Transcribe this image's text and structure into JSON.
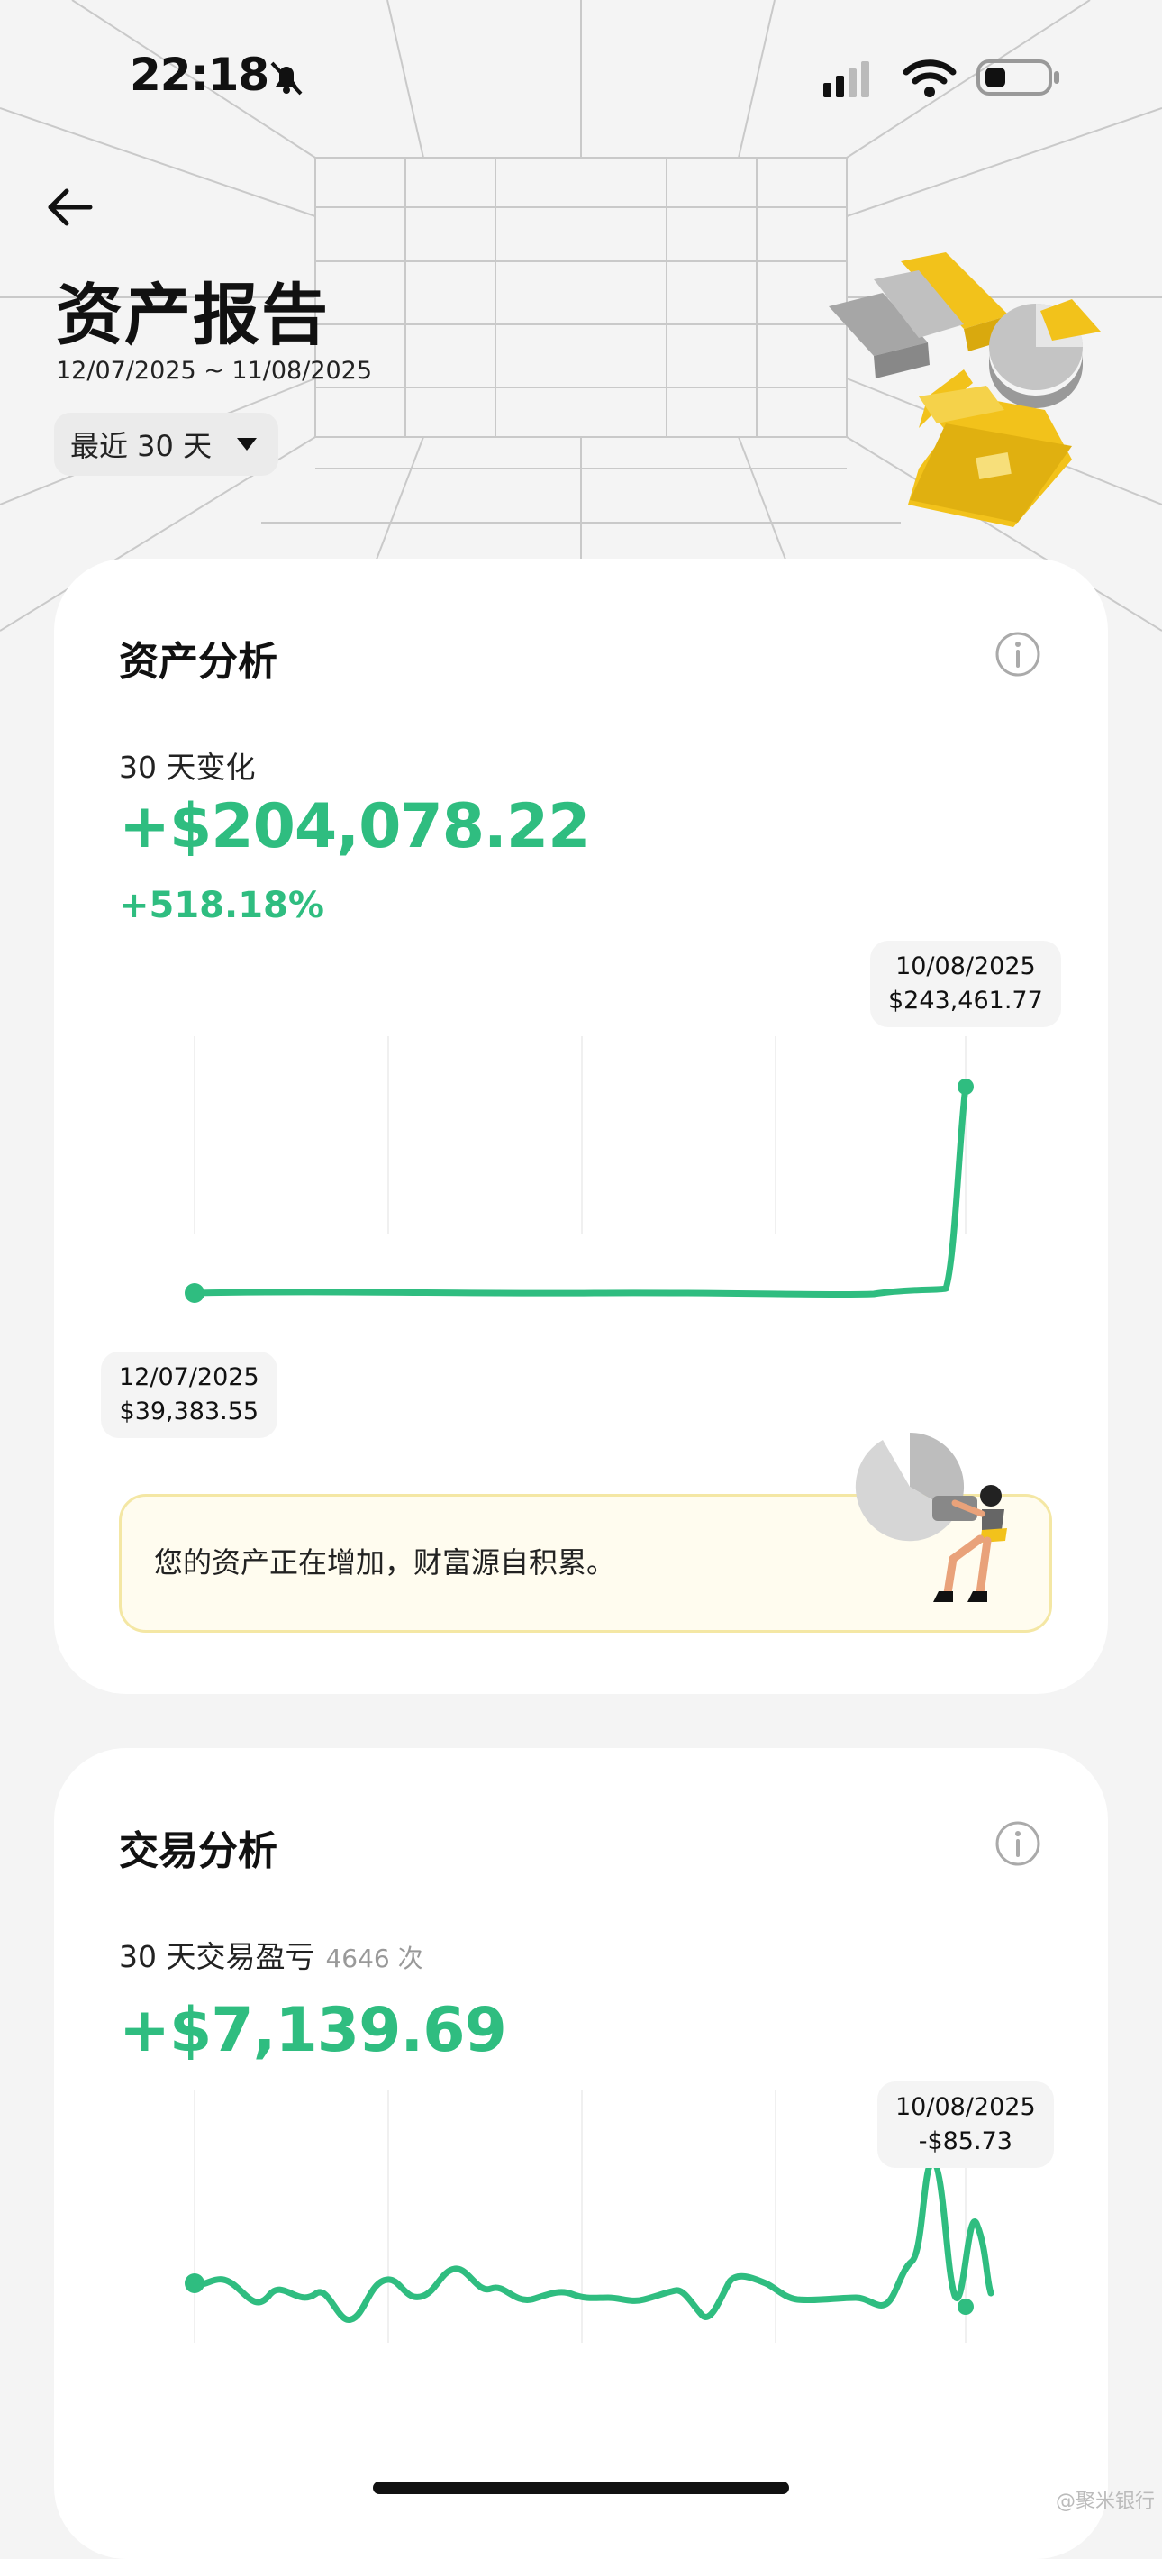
{
  "status_bar": {
    "time": "22:18"
  },
  "header": {
    "title": "资产报告",
    "date_range": "12/07/2025 ~ 11/08/2025",
    "range_select": "最近 30 天"
  },
  "asset_card": {
    "title": "资产分析",
    "change_label": "30 天变化",
    "change_value": "+$204,078.22",
    "change_pct": "+518.18%",
    "end_tip": {
      "date": "10/08/2025",
      "value": "$243,461.77"
    },
    "start_tip": {
      "date": "12/07/2025",
      "value": "$39,383.55"
    },
    "hint": "您的资产正在增加，财富源自积累。"
  },
  "trade_card": {
    "title": "交易分析",
    "pnl_label": "30 天交易盈亏",
    "trade_count": "4646 次",
    "pnl_value": "+$7,139.69",
    "end_tip": {
      "date": "10/08/2025",
      "value": "-$85.73"
    }
  },
  "watermark": "@聚米银行",
  "colors": {
    "accent_green": "#2fbd80",
    "yellow": "#f2c21b"
  },
  "chart_data": [
    {
      "type": "line",
      "title": "",
      "x": [
        "12/07/2025",
        "10/08/2025"
      ],
      "series": [
        {
          "values": [
            39383.55,
            243461.77
          ]
        }
      ]
    },
    {
      "type": "line",
      "title": "",
      "x": [
        "10/08/2025"
      ],
      "series": [
        {
          "values": [
            -85.73
          ]
        }
      ]
    }
  ]
}
